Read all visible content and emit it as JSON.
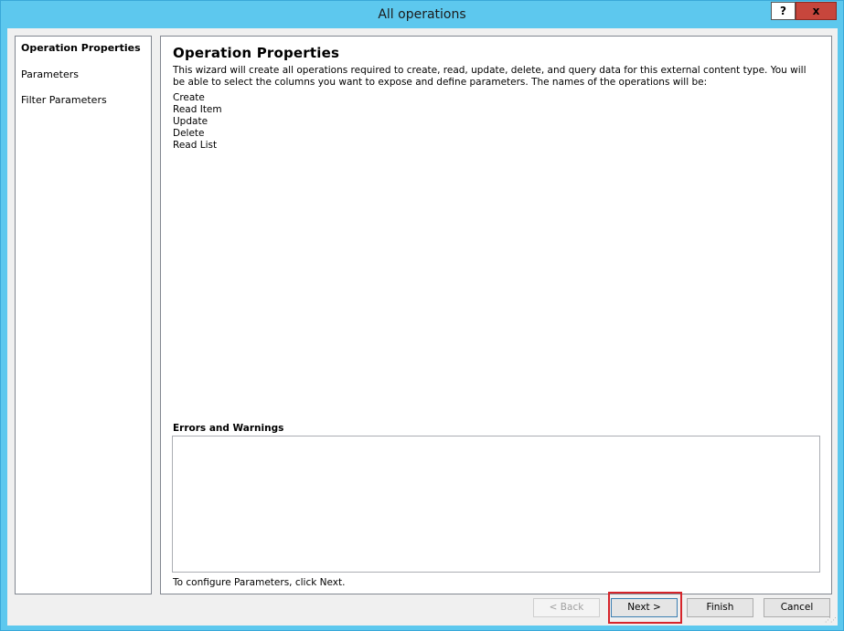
{
  "window": {
    "title": "All operations",
    "help_label": "?",
    "close_label": "x"
  },
  "nav": {
    "items": [
      {
        "label": "Operation Properties"
      },
      {
        "label": "Parameters"
      },
      {
        "label": "Filter Parameters"
      }
    ]
  },
  "content": {
    "title": "Operation Properties",
    "description": "This wizard will create all operations required to create, read, update, delete, and query data for this external content type. You will be able to select the columns you want to expose and define parameters. The names of the operations will be:",
    "operations": [
      "Create",
      "Read Item",
      "Update",
      "Delete",
      "Read List"
    ],
    "errors_label": "Errors and Warnings",
    "hint": "To configure Parameters, click Next."
  },
  "buttons": {
    "back": "< Back",
    "next": "Next >",
    "finish": "Finish",
    "cancel": "Cancel"
  }
}
